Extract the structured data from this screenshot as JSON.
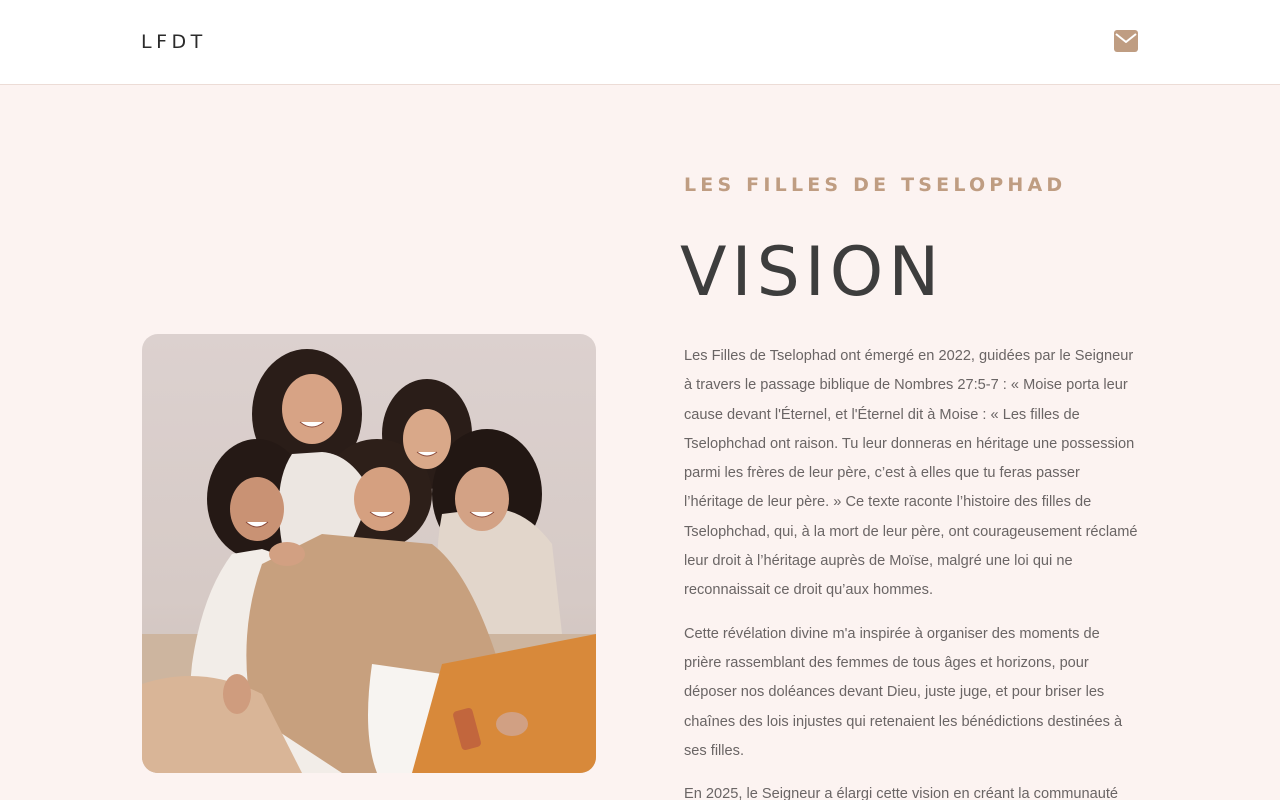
{
  "header": {
    "logo": "LFDT",
    "contact_icon": "envelope-icon"
  },
  "colors": {
    "accent": "#bf9d82",
    "heading": "#3d3d3d",
    "background": "#fcf3f1",
    "header_bg": "#ffffff"
  },
  "hero": {
    "kicker": "LES FILLES DE TSELOPHAD",
    "title": "VISION",
    "photo_alt": "Five smiling women posing together",
    "paragraphs": [
      "Les Filles de Tselophad ont émergé en 2022, guidées par le Seigneur à travers le passage biblique de Nombres 27:5-7 : « Moise porta leur cause devant l'Éternel, et l'Éternel dit à Moise : « Les filles de Tselophchad ont raison. Tu leur donneras en héritage une possession parmi les frères de leur père, c’est à elles que tu feras passer l’héritage de leur père. » Ce texte raconte l’histoire des filles de Tselophchad, qui, à la mort de leur père, ont courageusement réclamé leur droit à l’héritage auprès de Moïse, malgré une loi qui ne reconnaissait ce droit qu’aux hommes.",
      "Cette révélation divine m'a inspirée à organiser des moments de prière rassemblant des femmes de tous âges et horizons, pour déposer nos doléances devant Dieu, juste juge, et pour briser les chaînes des lois injustes qui retenaient les bénédictions destinées à ses filles.",
      "En 2025, le Seigneur a élargi cette vision en créant la communauté"
    ]
  }
}
